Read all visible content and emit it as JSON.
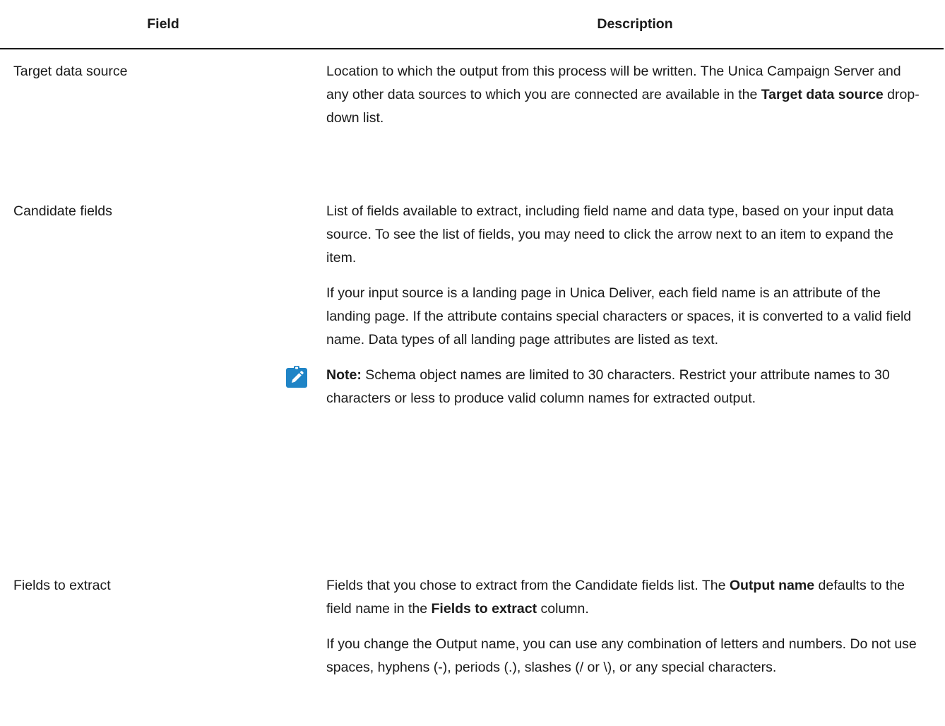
{
  "table": {
    "headers": {
      "field": "Field",
      "description": "Description"
    },
    "rows": [
      {
        "field": "Target data source",
        "p1": {
          "a": "Location to which the output from this process will be written. The  Unica Campaign Server and any other data sources to which you are connected are available in the ",
          "b": "Target data source",
          "c": " drop-down list."
        }
      },
      {
        "field": "Candidate fields",
        "p1": "List of fields available to extract, including field name and data type, based on your input data source. To see the list of fields, you may need to click the arrow next to an item to expand the item.",
        "p2": "If your input source is a landing page in Unica Deliver, each field name is an attribute of the landing page. If the attribute contains special characters or spaces, it is converted to a valid field name. Data types of all landing page attributes are listed as text.",
        "note": {
          "label": "Note:",
          "text": " Schema object names are limited to 30 characters. Restrict your attribute names to 30 characters or less to produce valid column names for extracted output.",
          "icon": "pencil-note-icon",
          "icon_color": "#1f84c6"
        }
      },
      {
        "field": "Fields to extract",
        "p1": {
          "a": "Fields that you chose to extract from the Candidate fields list. The ",
          "b": "Output name",
          "c": " defaults to the field name in the ",
          "d": "Fields to extract",
          "e": " column."
        },
        "p2": "If you change the Output name, you can use any combination of letters and numbers. Do not use spaces, hyphens (-), periods (.), slashes (/ or \\), or any special characters."
      }
    ]
  }
}
